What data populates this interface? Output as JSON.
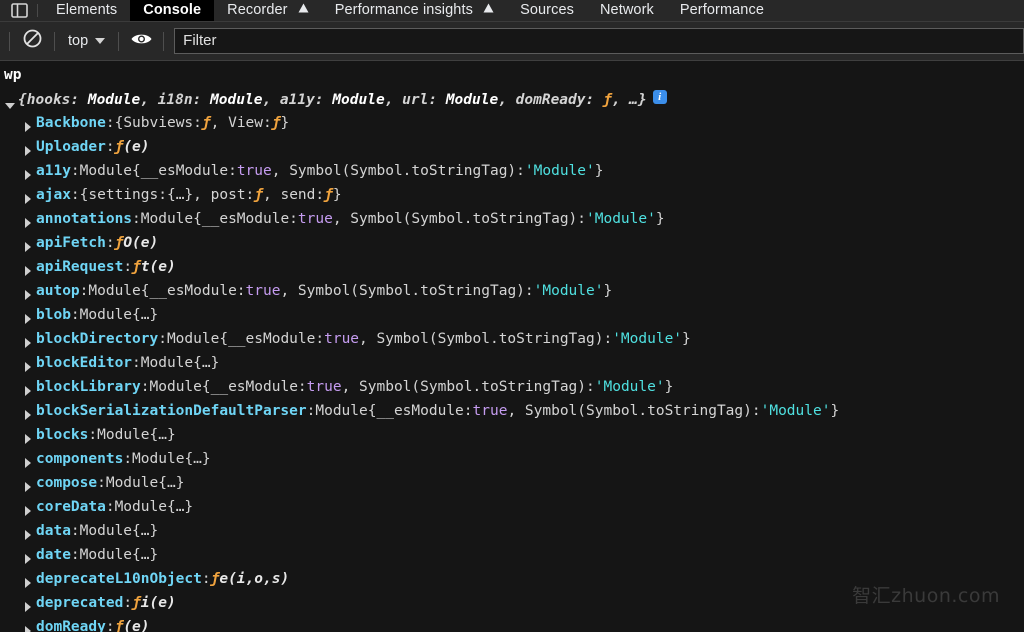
{
  "tabbar": {
    "panel_toggle_icon": "dock-panel-icon",
    "tabs": [
      {
        "label": "Elements",
        "active": false,
        "warning": false
      },
      {
        "label": "Console",
        "active": true,
        "warning": false
      },
      {
        "label": "Recorder",
        "active": false,
        "warning": true
      },
      {
        "label": "Performance insights",
        "active": false,
        "warning": true
      },
      {
        "label": "Sources",
        "active": false,
        "warning": false
      },
      {
        "label": "Network",
        "active": false,
        "warning": false
      },
      {
        "label": "Performance",
        "active": false,
        "warning": false
      }
    ]
  },
  "toolbar": {
    "clear_console_icon": "no-entry-icon",
    "context_label": "top",
    "context_caret_icon": "chevron-down-icon",
    "live_expression_icon": "eye-icon",
    "filter_placeholder": "Filter",
    "filter_value": ""
  },
  "console": {
    "input_echo": "wp",
    "root": {
      "toggle_state": "expanded",
      "preview_parts": [
        {
          "text": "{",
          "kind": "punc"
        },
        {
          "text": "hooks: ",
          "kind": "plain"
        },
        {
          "text": "Module",
          "kind": "mod"
        },
        {
          "text": ", i18n: ",
          "kind": "plain"
        },
        {
          "text": "Module",
          "kind": "mod"
        },
        {
          "text": ", a11y: ",
          "kind": "plain"
        },
        {
          "text": "Module",
          "kind": "mod"
        },
        {
          "text": ", url: ",
          "kind": "plain"
        },
        {
          "text": "Module",
          "kind": "mod"
        },
        {
          "text": ", domReady: ",
          "kind": "plain"
        },
        {
          "text": "ƒ",
          "kind": "fn"
        },
        {
          "text": ", …}",
          "kind": "plain"
        }
      ],
      "info_badge": "i"
    },
    "properties": [
      {
        "key": "Backbone",
        "parts": [
          {
            "t": "{",
            "c": "punc"
          },
          {
            "t": "Subviews: ",
            "c": "plain"
          },
          {
            "t": "ƒ",
            "c": "fnsym"
          },
          {
            "t": ", View: ",
            "c": "plain"
          },
          {
            "t": "ƒ",
            "c": "fnsym"
          },
          {
            "t": "}",
            "c": "punc"
          }
        ]
      },
      {
        "key": "Uploader",
        "parts": [
          {
            "t": "ƒ ",
            "c": "fnsym"
          },
          {
            "t": "(e)",
            "c": "fnsig"
          }
        ]
      },
      {
        "key": "a11y",
        "parts": [
          {
            "t": "Module ",
            "c": "ctor"
          },
          {
            "t": "{__esModule: ",
            "c": "plain"
          },
          {
            "t": "true",
            "c": "bool"
          },
          {
            "t": ", Symbol(Symbol.toStringTag): ",
            "c": "plain"
          },
          {
            "t": "'Module'",
            "c": "str"
          },
          {
            "t": "}",
            "c": "punc"
          }
        ]
      },
      {
        "key": "ajax",
        "parts": [
          {
            "t": "{settings: ",
            "c": "plain"
          },
          {
            "t": "{…}",
            "c": "plain"
          },
          {
            "t": ", post: ",
            "c": "plain"
          },
          {
            "t": "ƒ",
            "c": "fnsym"
          },
          {
            "t": ", send: ",
            "c": "plain"
          },
          {
            "t": "ƒ",
            "c": "fnsym"
          },
          {
            "t": "}",
            "c": "punc"
          }
        ]
      },
      {
        "key": "annotations",
        "parts": [
          {
            "t": "Module ",
            "c": "ctor"
          },
          {
            "t": "{__esModule: ",
            "c": "plain"
          },
          {
            "t": "true",
            "c": "bool"
          },
          {
            "t": ", Symbol(Symbol.toStringTag): ",
            "c": "plain"
          },
          {
            "t": "'Module'",
            "c": "str"
          },
          {
            "t": "}",
            "c": "punc"
          }
        ]
      },
      {
        "key": "apiFetch",
        "parts": [
          {
            "t": "ƒ ",
            "c": "fnsym"
          },
          {
            "t": "O(e)",
            "c": "fnsig"
          }
        ]
      },
      {
        "key": "apiRequest",
        "parts": [
          {
            "t": "ƒ ",
            "c": "fnsym"
          },
          {
            "t": "t(e)",
            "c": "fnsig"
          }
        ]
      },
      {
        "key": "autop",
        "parts": [
          {
            "t": "Module ",
            "c": "ctor"
          },
          {
            "t": "{__esModule: ",
            "c": "plain"
          },
          {
            "t": "true",
            "c": "bool"
          },
          {
            "t": ", Symbol(Symbol.toStringTag): ",
            "c": "plain"
          },
          {
            "t": "'Module'",
            "c": "str"
          },
          {
            "t": "}",
            "c": "punc"
          }
        ]
      },
      {
        "key": "blob",
        "parts": [
          {
            "t": "Module ",
            "c": "ctor"
          },
          {
            "t": "{…}",
            "c": "plain"
          }
        ]
      },
      {
        "key": "blockDirectory",
        "parts": [
          {
            "t": "Module ",
            "c": "ctor"
          },
          {
            "t": "{__esModule: ",
            "c": "plain"
          },
          {
            "t": "true",
            "c": "bool"
          },
          {
            "t": ", Symbol(Symbol.toStringTag): ",
            "c": "plain"
          },
          {
            "t": "'Module'",
            "c": "str"
          },
          {
            "t": "}",
            "c": "punc"
          }
        ]
      },
      {
        "key": "blockEditor",
        "parts": [
          {
            "t": "Module ",
            "c": "ctor"
          },
          {
            "t": "{…}",
            "c": "plain"
          }
        ]
      },
      {
        "key": "blockLibrary",
        "parts": [
          {
            "t": "Module ",
            "c": "ctor"
          },
          {
            "t": "{__esModule: ",
            "c": "plain"
          },
          {
            "t": "true",
            "c": "bool"
          },
          {
            "t": ", Symbol(Symbol.toStringTag): ",
            "c": "plain"
          },
          {
            "t": "'Module'",
            "c": "str"
          },
          {
            "t": "}",
            "c": "punc"
          }
        ]
      },
      {
        "key": "blockSerializationDefaultParser",
        "parts": [
          {
            "t": "Module ",
            "c": "ctor"
          },
          {
            "t": "{__esModule: ",
            "c": "plain"
          },
          {
            "t": "true",
            "c": "bool"
          },
          {
            "t": ", Symbol(Symbol.toStringTag): ",
            "c": "plain"
          },
          {
            "t": "'Module'",
            "c": "str"
          },
          {
            "t": "}",
            "c": "punc"
          }
        ]
      },
      {
        "key": "blocks",
        "parts": [
          {
            "t": "Module ",
            "c": "ctor"
          },
          {
            "t": "{…}",
            "c": "plain"
          }
        ]
      },
      {
        "key": "components",
        "parts": [
          {
            "t": "Module ",
            "c": "ctor"
          },
          {
            "t": "{…}",
            "c": "plain"
          }
        ]
      },
      {
        "key": "compose",
        "parts": [
          {
            "t": "Module ",
            "c": "ctor"
          },
          {
            "t": "{…}",
            "c": "plain"
          }
        ]
      },
      {
        "key": "coreData",
        "parts": [
          {
            "t": "Module ",
            "c": "ctor"
          },
          {
            "t": "{…}",
            "c": "plain"
          }
        ]
      },
      {
        "key": "data",
        "parts": [
          {
            "t": "Module ",
            "c": "ctor"
          },
          {
            "t": "{…}",
            "c": "plain"
          }
        ]
      },
      {
        "key": "date",
        "parts": [
          {
            "t": "Module ",
            "c": "ctor"
          },
          {
            "t": "{…}",
            "c": "plain"
          }
        ]
      },
      {
        "key": "deprecateL10nObject",
        "parts": [
          {
            "t": "ƒ ",
            "c": "fnsym"
          },
          {
            "t": "e(i,o,s)",
            "c": "fnsig"
          }
        ]
      },
      {
        "key": "deprecated",
        "parts": [
          {
            "t": "ƒ ",
            "c": "fnsym"
          },
          {
            "t": "i(e)",
            "c": "fnsig"
          }
        ]
      },
      {
        "key": "domReady",
        "parts": [
          {
            "t": "ƒ ",
            "c": "fnsym"
          },
          {
            "t": "(e)",
            "c": "fnsig"
          }
        ]
      }
    ]
  },
  "watermark": {
    "text": "智汇zhuon.com"
  },
  "colors": {
    "background": "#151515",
    "chrome": "#282828",
    "key": "#6fd5f5",
    "string": "#4fe0e0",
    "boolean": "#c59cf0",
    "function": "#f0a33e",
    "plain": "#d4d4d4",
    "info_badge": "#3b8eea"
  }
}
